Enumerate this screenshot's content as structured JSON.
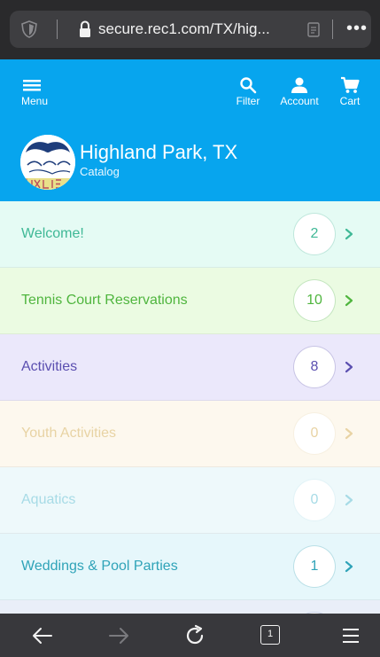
{
  "browser": {
    "url": "secure.rec1.com/TX/hig...",
    "tabs_count": "1"
  },
  "header": {
    "menu_label": "Menu",
    "filter_label": "Filter",
    "account_label": "Account",
    "cart_label": "Cart",
    "title": "Highland Park, TX",
    "subtitle": "Catalog"
  },
  "catalog": {
    "items": [
      {
        "label": "Welcome!",
        "count": "2",
        "bg": "#e5fbf4",
        "color": "#3fb896"
      },
      {
        "label": "Tennis Court Reservations",
        "count": "10",
        "bg": "#ebfbe2",
        "color": "#4fb53e"
      },
      {
        "label": "Activities",
        "count": "8",
        "bg": "#ebe8fb",
        "color": "#5b4fb0"
      },
      {
        "label": "Youth Activities",
        "count": "0",
        "bg": "#fdf8ee",
        "color": "#e8d3a4"
      },
      {
        "label": "Aquatics",
        "count": "0",
        "bg": "#eef9fb",
        "color": "#a7dbe6"
      },
      {
        "label": "Weddings & Pool Parties",
        "count": "1",
        "bg": "#e6f7fb",
        "color": "#2fa3b8"
      }
    ]
  },
  "colors": {
    "header_bg": "#07a5ee",
    "browser_chrome": "#38383c"
  }
}
